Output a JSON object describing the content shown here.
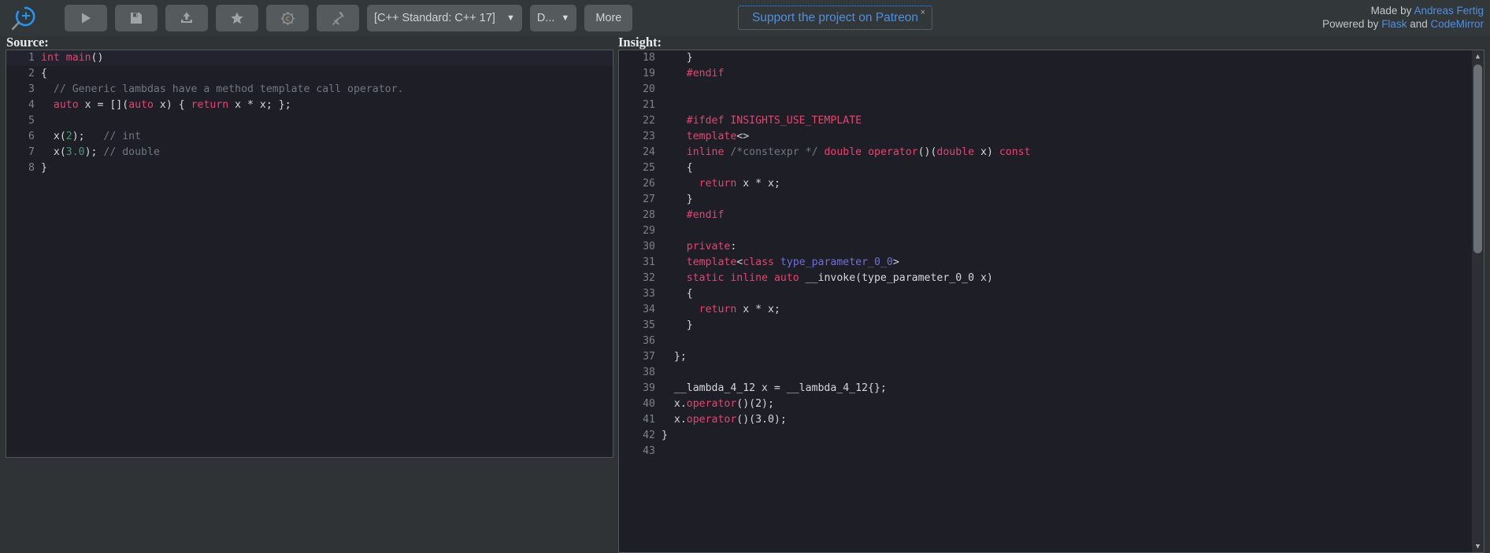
{
  "toolbar": {
    "logo_name": "cppinsights-logo",
    "buttons": [
      {
        "name": "run-button",
        "icon": "play-icon",
        "label": ""
      },
      {
        "name": "save-button",
        "icon": "floppy-disk-icon",
        "label": ""
      },
      {
        "name": "upload-button",
        "icon": "upload-icon",
        "label": ""
      },
      {
        "name": "favorite-button",
        "icon": "star-icon",
        "label": ""
      },
      {
        "name": "settings-button",
        "icon": "gear-euro-icon",
        "label": ""
      },
      {
        "name": "share-button",
        "icon": "pin-icon",
        "label": ""
      }
    ],
    "standard_select": {
      "value": "[C++ Standard: C++ 17]",
      "caret": "▼"
    },
    "second_select": {
      "value": "D...",
      "caret": "▼"
    },
    "more_label": "More"
  },
  "patreon": {
    "label": "Support the project on Patreon",
    "close": "×"
  },
  "credits": {
    "made_by_prefix": "Made by ",
    "made_by_name": "Andreas Fertig",
    "powered_prefix": "Powered by ",
    "powered_1": "Flask",
    "powered_mid": " and ",
    "powered_2": "CodeMirror"
  },
  "panels": {
    "source_title": "Source:",
    "insight_title": "Insight:"
  },
  "source": {
    "lines": [
      {
        "n": "1",
        "active": true,
        "tokens": [
          {
            "t": "int",
            "c": "kw"
          },
          {
            "t": " ",
            "c": "pun"
          },
          {
            "t": "main",
            "c": "fn"
          },
          {
            "t": "()",
            "c": "pun"
          }
        ]
      },
      {
        "n": "2",
        "active": false,
        "tokens": [
          {
            "t": "{",
            "c": "pun"
          }
        ]
      },
      {
        "n": "3",
        "active": false,
        "tokens": [
          {
            "t": "  // Generic lambdas have a method template call operator.",
            "c": "cm"
          }
        ]
      },
      {
        "n": "4",
        "active": false,
        "tokens": [
          {
            "t": "  ",
            "c": "pun"
          },
          {
            "t": "auto",
            "c": "kw"
          },
          {
            "t": " x = [](",
            "c": "pun"
          },
          {
            "t": "auto",
            "c": "kw"
          },
          {
            "t": " x) { ",
            "c": "pun"
          },
          {
            "t": "return",
            "c": "kw"
          },
          {
            "t": " x * x; };",
            "c": "pun"
          }
        ]
      },
      {
        "n": "5",
        "active": false,
        "tokens": [
          {
            "t": "",
            "c": "pun"
          }
        ]
      },
      {
        "n": "6",
        "active": false,
        "tokens": [
          {
            "t": "  x(",
            "c": "pun"
          },
          {
            "t": "2",
            "c": "num"
          },
          {
            "t": ");   ",
            "c": "pun"
          },
          {
            "t": "// int",
            "c": "cm"
          }
        ]
      },
      {
        "n": "7",
        "active": false,
        "tokens": [
          {
            "t": "  x(",
            "c": "pun"
          },
          {
            "t": "3.0",
            "c": "num"
          },
          {
            "t": "); ",
            "c": "pun"
          },
          {
            "t": "// double",
            "c": "cm"
          }
        ]
      },
      {
        "n": "8",
        "active": false,
        "tokens": [
          {
            "t": "}",
            "c": "pun"
          }
        ]
      }
    ]
  },
  "insight": {
    "lines": [
      {
        "n": "18",
        "tokens": [
          {
            "t": "    }",
            "c": "pun"
          }
        ]
      },
      {
        "n": "19",
        "tokens": [
          {
            "t": "    ",
            "c": "pun"
          },
          {
            "t": "#endif",
            "c": "pp"
          }
        ]
      },
      {
        "n": "20",
        "tokens": [
          {
            "t": "",
            "c": "pun"
          }
        ]
      },
      {
        "n": "21",
        "tokens": [
          {
            "t": "",
            "c": "pun"
          }
        ]
      },
      {
        "n": "22",
        "tokens": [
          {
            "t": "    ",
            "c": "pun"
          },
          {
            "t": "#ifdef INSIGHTS_USE_TEMPLATE",
            "c": "pp"
          }
        ]
      },
      {
        "n": "23",
        "tokens": [
          {
            "t": "    ",
            "c": "pun"
          },
          {
            "t": "template",
            "c": "kw"
          },
          {
            "t": "<>",
            "c": "pun"
          }
        ]
      },
      {
        "n": "24",
        "tokens": [
          {
            "t": "    ",
            "c": "pun"
          },
          {
            "t": "inline",
            "c": "kw"
          },
          {
            "t": " ",
            "c": "pun"
          },
          {
            "t": "/*constexpr */",
            "c": "cm"
          },
          {
            "t": " ",
            "c": "pun"
          },
          {
            "t": "double",
            "c": "kw"
          },
          {
            "t": " ",
            "c": "pun"
          },
          {
            "t": "operator",
            "c": "fn"
          },
          {
            "t": "()(",
            "c": "pun"
          },
          {
            "t": "double",
            "c": "kw"
          },
          {
            "t": " x) ",
            "c": "pun"
          },
          {
            "t": "const",
            "c": "kw"
          }
        ]
      },
      {
        "n": "25",
        "tokens": [
          {
            "t": "    {",
            "c": "pun"
          }
        ]
      },
      {
        "n": "26",
        "tokens": [
          {
            "t": "      ",
            "c": "pun"
          },
          {
            "t": "return",
            "c": "kw"
          },
          {
            "t": " x * x;",
            "c": "pun"
          }
        ]
      },
      {
        "n": "27",
        "tokens": [
          {
            "t": "    }",
            "c": "pun"
          }
        ]
      },
      {
        "n": "28",
        "tokens": [
          {
            "t": "    ",
            "c": "pun"
          },
          {
            "t": "#endif",
            "c": "pp"
          }
        ]
      },
      {
        "n": "29",
        "tokens": [
          {
            "t": "",
            "c": "pun"
          }
        ]
      },
      {
        "n": "30",
        "tokens": [
          {
            "t": "    ",
            "c": "pun"
          },
          {
            "t": "private",
            "c": "kw"
          },
          {
            "t": ":",
            "c": "pun"
          }
        ]
      },
      {
        "n": "31",
        "tokens": [
          {
            "t": "    ",
            "c": "pun"
          },
          {
            "t": "template",
            "c": "kw"
          },
          {
            "t": "<",
            "c": "pun"
          },
          {
            "t": "class",
            "c": "kw"
          },
          {
            "t": " ",
            "c": "pun"
          },
          {
            "t": "type_parameter_0_0",
            "c": "tp"
          },
          {
            "t": ">",
            "c": "pun"
          }
        ]
      },
      {
        "n": "32",
        "tokens": [
          {
            "t": "    ",
            "c": "pun"
          },
          {
            "t": "static",
            "c": "kw"
          },
          {
            "t": " ",
            "c": "pun"
          },
          {
            "t": "inline",
            "c": "kw"
          },
          {
            "t": " ",
            "c": "pun"
          },
          {
            "t": "auto",
            "c": "kw"
          },
          {
            "t": " __invoke(type_parameter_0_0 x)",
            "c": "pun"
          }
        ]
      },
      {
        "n": "33",
        "tokens": [
          {
            "t": "    {",
            "c": "pun"
          }
        ]
      },
      {
        "n": "34",
        "tokens": [
          {
            "t": "      ",
            "c": "pun"
          },
          {
            "t": "return",
            "c": "kw"
          },
          {
            "t": " x * x;",
            "c": "pun"
          }
        ]
      },
      {
        "n": "35",
        "tokens": [
          {
            "t": "    }",
            "c": "pun"
          }
        ]
      },
      {
        "n": "36",
        "tokens": [
          {
            "t": "",
            "c": "pun"
          }
        ]
      },
      {
        "n": "37",
        "tokens": [
          {
            "t": "  };",
            "c": "pun"
          }
        ]
      },
      {
        "n": "38",
        "tokens": [
          {
            "t": "",
            "c": "pun"
          }
        ]
      },
      {
        "n": "39",
        "tokens": [
          {
            "t": "  __lambda_4_12 x = __lambda_4_12{};",
            "c": "pun"
          }
        ]
      },
      {
        "n": "40",
        "tokens": [
          {
            "t": "  x.",
            "c": "pun"
          },
          {
            "t": "operator",
            "c": "fn"
          },
          {
            "t": "()(2);",
            "c": "pun"
          }
        ]
      },
      {
        "n": "41",
        "tokens": [
          {
            "t": "  x.",
            "c": "pun"
          },
          {
            "t": "operator",
            "c": "fn"
          },
          {
            "t": "()(3.0);",
            "c": "pun"
          }
        ]
      },
      {
        "n": "42",
        "tokens": [
          {
            "t": "}",
            "c": "pun"
          }
        ]
      },
      {
        "n": "43",
        "tokens": [
          {
            "t": "",
            "c": "pun"
          }
        ]
      }
    ]
  },
  "colors": {
    "accent_blue": "#4f8fe0",
    "keyword": "#e8436f",
    "comment": "#6f7780",
    "number": "#3a9f6e",
    "template_param": "#6f6fd4",
    "editor_bg": "#1e1f26",
    "toolbar_bg": "#32373a",
    "page_bg": "#2f3336"
  }
}
